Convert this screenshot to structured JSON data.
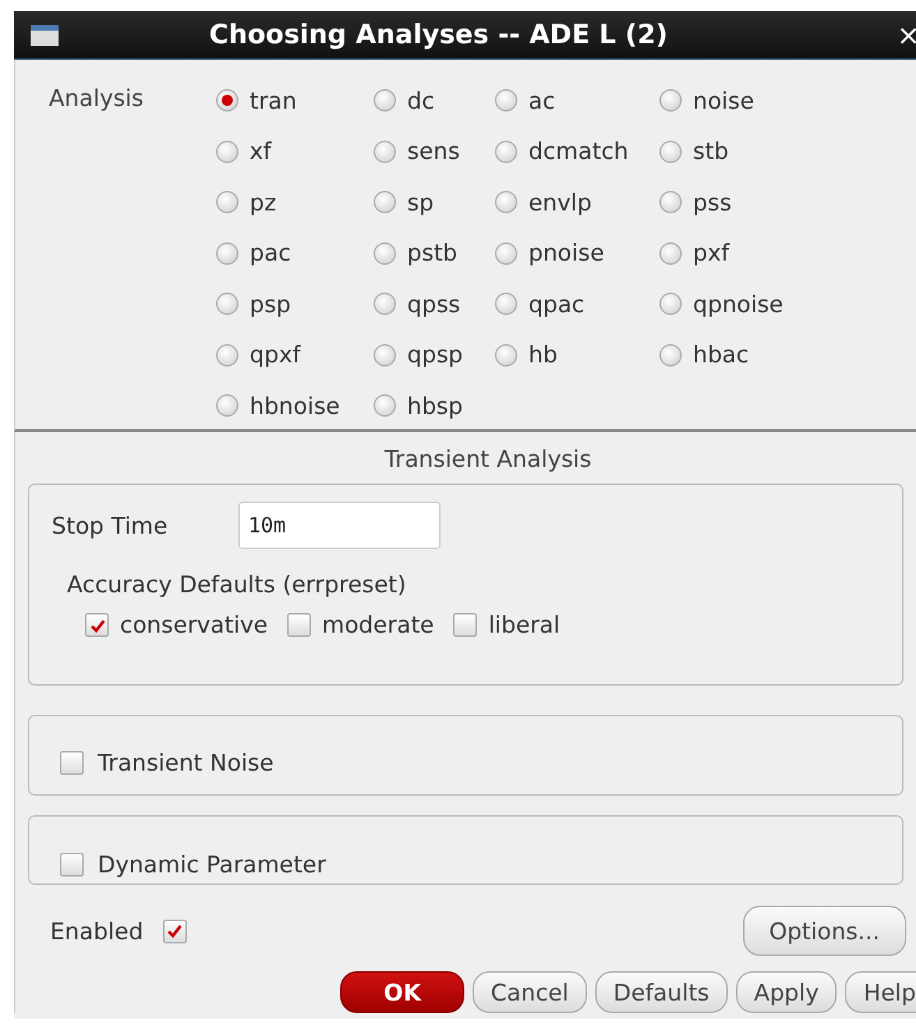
{
  "window": {
    "title": "Choosing Analyses -- ADE L (2)",
    "close": "×"
  },
  "analysis": {
    "label": "Analysis",
    "options": [
      {
        "label": "tran",
        "selected": true
      },
      {
        "label": "dc",
        "selected": false
      },
      {
        "label": "ac",
        "selected": false
      },
      {
        "label": "noise",
        "selected": false
      },
      {
        "label": "xf",
        "selected": false
      },
      {
        "label": "sens",
        "selected": false
      },
      {
        "label": "dcmatch",
        "selected": false
      },
      {
        "label": "stb",
        "selected": false
      },
      {
        "label": "pz",
        "selected": false
      },
      {
        "label": "sp",
        "selected": false
      },
      {
        "label": "envlp",
        "selected": false
      },
      {
        "label": "pss",
        "selected": false
      },
      {
        "label": "pac",
        "selected": false
      },
      {
        "label": "pstb",
        "selected": false
      },
      {
        "label": "pnoise",
        "selected": false
      },
      {
        "label": "pxf",
        "selected": false
      },
      {
        "label": "psp",
        "selected": false
      },
      {
        "label": "qpss",
        "selected": false
      },
      {
        "label": "qpac",
        "selected": false
      },
      {
        "label": "qpnoise",
        "selected": false
      },
      {
        "label": "qpxf",
        "selected": false
      },
      {
        "label": "qpsp",
        "selected": false
      },
      {
        "label": "hb",
        "selected": false
      },
      {
        "label": "hbac",
        "selected": false
      },
      {
        "label": "hbnoise",
        "selected": false
      },
      {
        "label": "hbsp",
        "selected": false
      }
    ]
  },
  "section_title": "Transient Analysis",
  "stop_time": {
    "label": "Stop Time",
    "value": "10m"
  },
  "accuracy": {
    "label": "Accuracy Defaults (errpreset)",
    "options": [
      {
        "label": "conservative",
        "checked": true
      },
      {
        "label": "moderate",
        "checked": false
      },
      {
        "label": "liberal",
        "checked": false
      }
    ]
  },
  "transient_noise": {
    "label": "Transient Noise",
    "checked": false
  },
  "dynamic_parameter": {
    "label": "Dynamic Parameter",
    "checked": false
  },
  "enabled": {
    "label": "Enabled",
    "checked": true
  },
  "options_button": "Options...",
  "buttons": [
    {
      "label": "OK",
      "kind": "primary"
    },
    {
      "label": "Cancel",
      "kind": "normal"
    },
    {
      "label": "Defaults",
      "kind": "normal"
    },
    {
      "label": "Apply",
      "kind": "normal"
    },
    {
      "label": "Help",
      "kind": "normal"
    }
  ]
}
